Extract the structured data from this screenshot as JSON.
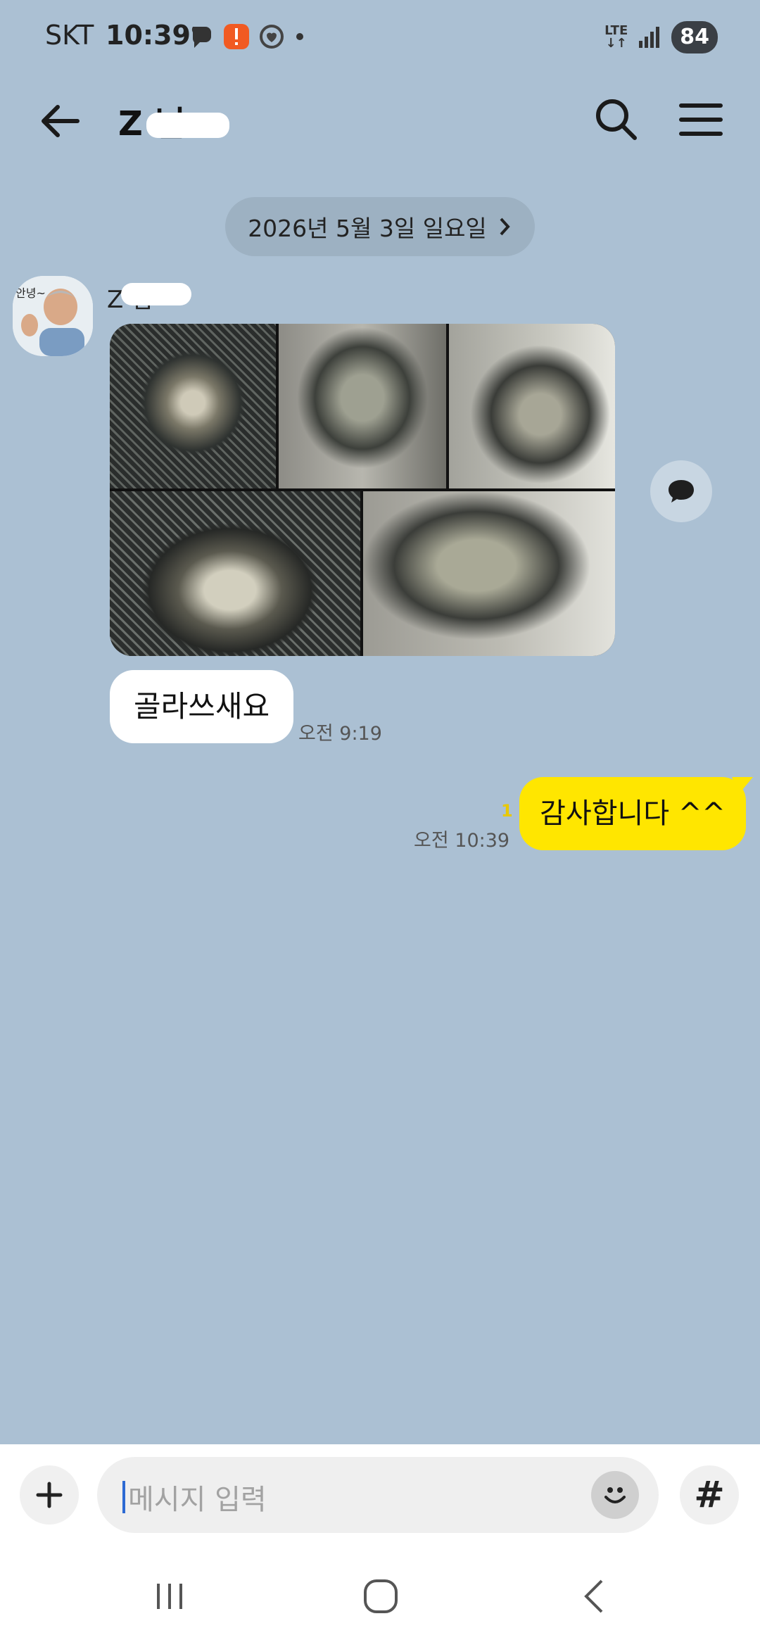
{
  "status_bar": {
    "carrier": "SKT",
    "time": "10:39",
    "network": "LTE",
    "battery": "84"
  },
  "header": {
    "title": "Z    님",
    "search_icon": "search-icon",
    "menu_icon": "hamburger-menu-icon"
  },
  "chat": {
    "date_label": "2026년 5월 3일 일요일",
    "sender_name": "Z    님",
    "incoming": {
      "text": "골라쓰새요",
      "time": "오전 9:19"
    },
    "outgoing": {
      "text": "감사합니다 ^^",
      "unread_count": "1",
      "time": "오전 10:39"
    },
    "photos_count": 5
  },
  "input": {
    "placeholder": "메시지 입력",
    "value": ""
  },
  "colors": {
    "background": "#abc0d3",
    "my_bubble": "#ffe600",
    "their_bubble": "#ffffff"
  }
}
